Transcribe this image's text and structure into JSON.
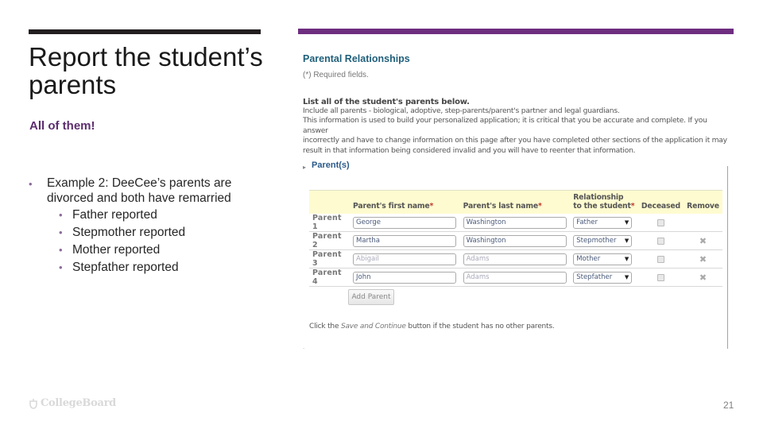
{
  "slide": {
    "title": "Report the student’s parents",
    "subtitle": "All of them!",
    "bullet": "Example 2:  DeeCee’s parents are divorced and both have remarried",
    "sub_bullets": [
      "Father reported",
      "Stepmother reported",
      "Mother reported",
      "Stepfather reported"
    ],
    "bullet_icon": "bullet-dot",
    "logo_text": "CollegeBoard",
    "page_number": "21",
    "colors": {
      "accent_purple": "#6e2e80",
      "title_bar": "#231f20",
      "subtitle": "#5c2d6e"
    }
  },
  "screenshot": {
    "heading": "Parental Relationships",
    "required_note": "(*) Required fields.",
    "list_heading": "List all of the student's parents below.",
    "description": [
      "Include all parents - biological, adoptive, step-parents/parent's partner and legal guardians.",
      "This information is used to build your personalized application; it is critical that you be accurate and complete. If you answer",
      "incorrectly and have to change information on this page after you have completed other sections of the application it may",
      "result in that information being considered invalid and you will have to reenter that information."
    ],
    "section_title": "Parent(s)",
    "table": {
      "headers": {
        "first_name": "Parent's first name",
        "last_name": "Parent's last name",
        "relationship_line1": "Relationship",
        "relationship_line2": "to the student",
        "required_mark": "*",
        "deceased": "Deceased",
        "remove": "Remove"
      },
      "rows": [
        {
          "label": "Parent 1",
          "first": "George",
          "last": "Washington",
          "relationship": "Father",
          "deceased": false,
          "removable": false
        },
        {
          "label": "Parent 2",
          "first": "Martha",
          "last": "Washington",
          "relationship": "Stepmother",
          "deceased": false,
          "removable": true
        },
        {
          "label": "Parent 3",
          "first": "Abigail",
          "last": "Adams",
          "relationship": "Mother",
          "deceased": false,
          "removable": true
        },
        {
          "label": "Parent 4",
          "first": "John",
          "last": "Adams",
          "relationship": "Stepfather",
          "deceased": false,
          "removable": true
        }
      ]
    },
    "add_button": "Add Parent",
    "hint_prefix": "Click the ",
    "hint_italic": "Save and Continue",
    "hint_suffix": " button if the student has no other parents."
  }
}
